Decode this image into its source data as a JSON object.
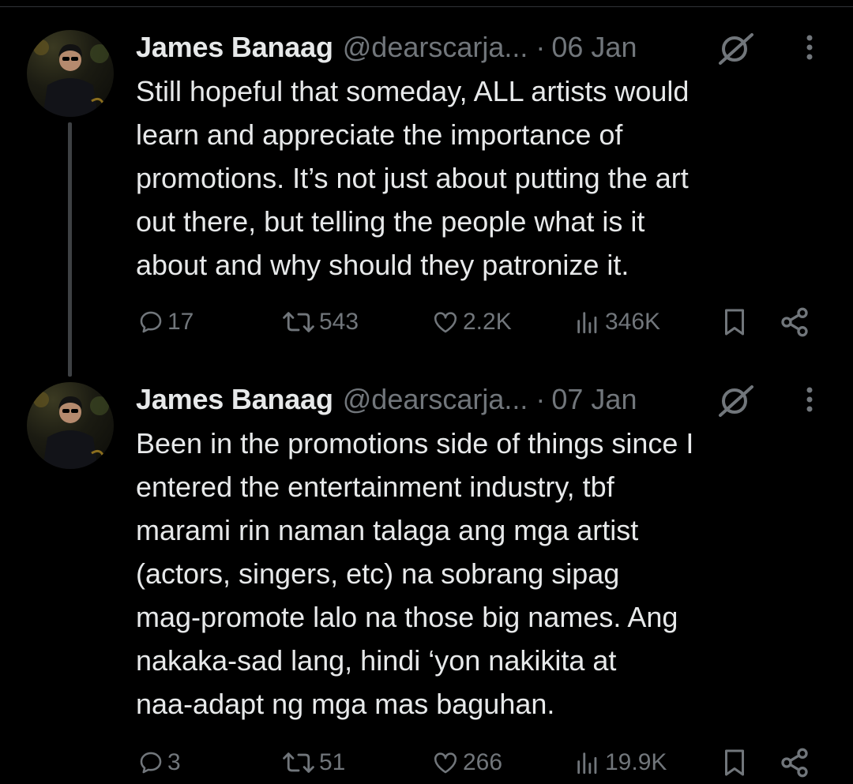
{
  "tweets": [
    {
      "author_name": "James Banaag",
      "handle": "@dearscarja...",
      "separator": "·",
      "date": "06 Jan",
      "text_lines": [
        "Still hopeful that someday, ALL artists would",
        "learn and appreciate the importance of",
        "promotions. It’s not just about putting the art",
        "out there, but telling the people what is it",
        "about and why should they patronize it."
      ],
      "stats": {
        "replies": "17",
        "reposts": "543",
        "likes": "2.2K",
        "views": "346K"
      }
    },
    {
      "author_name": "James Banaag",
      "handle": "@dearscarja...",
      "separator": "·",
      "date": "07 Jan",
      "text_lines": [
        "Been in the promotions side of things since I",
        "entered the entertainment industry, tbf",
        "marami rin naman talaga ang mga artist",
        "(actors, singers, etc) na sobrang sipag",
        "mag-promote lalo na those big names. Ang",
        "nakaka-sad lang, hindi ‘yon nakikita at",
        "naa-adapt ng mga mas baguhan."
      ],
      "stats": {
        "replies": "3",
        "reposts": "51",
        "likes": "266",
        "views": "19.9K"
      }
    }
  ],
  "icons": {
    "grok": "grok-icon",
    "more": "more-icon",
    "reply": "reply-icon",
    "repost": "repost-icon",
    "like": "heart-icon",
    "views": "views-icon",
    "bookmark": "bookmark-icon",
    "share": "share-icon"
  },
  "colors": {
    "background": "#000000",
    "primary_text": "#e7e9ea",
    "secondary_text": "#71767b",
    "thread_line": "#3e4144"
  }
}
